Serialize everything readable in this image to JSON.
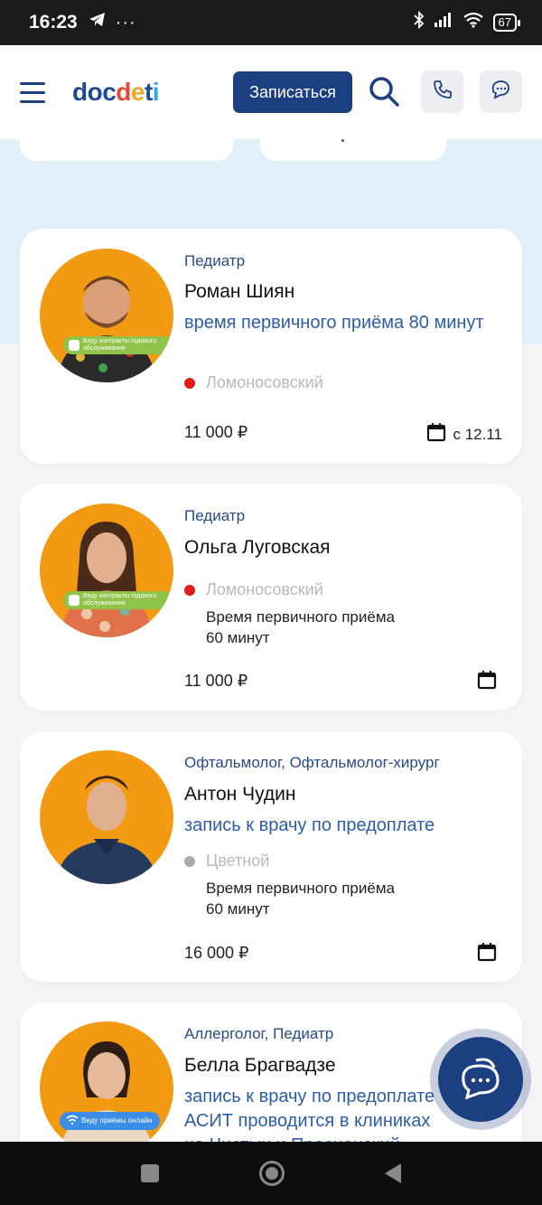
{
  "status_bar": {
    "time": "16:23",
    "battery": "67"
  },
  "header": {
    "logo": {
      "part1": "doc",
      "part2": "d",
      "part3": "e",
      "part4": "t",
      "part5": "i"
    },
    "signup_label": "Записаться"
  },
  "doctors": [
    {
      "specialty": "Педиатр",
      "name": "Роман Шиян",
      "promo": "время первичного приёма 80 минут",
      "clinic": "Ломоносовский",
      "price": "11 000 ₽",
      "date": "с 12.11",
      "badge": "Веду контракты годового обслуживания"
    },
    {
      "specialty": "Педиатр",
      "name": "Ольга Луговская",
      "clinic": "Ломоносовский",
      "time_line1": "Время первичного приёма",
      "time_line2": "60 минут",
      "price": "11 000 ₽",
      "badge": "Веду контракты годового обслуживания"
    },
    {
      "specialty": "Офтальмолог, Офтальмолог-хирург",
      "name": "Антон Чудин",
      "promo": "запись к врачу по предоплате",
      "clinic": "Цветной",
      "time_line1": "Время первичного приёма",
      "time_line2": "60 минут",
      "price": "16 000 ₽"
    },
    {
      "specialty": "Аллерголог, Педиатр",
      "name": "Белла Брагвадзе",
      "promo_line1": "запись к врачу по предоплате",
      "promo_line2": "АСИТ проводится в клиниках",
      "promo_line3": "на Чистых и Пресненский",
      "badge": "Веду приёмы онлайн"
    }
  ],
  "colors": {
    "brand": "#1c3f82",
    "accent_text": "#2c5da6",
    "clinic_dot_red": "#e11a1a",
    "clinic_dot_grey": "#aaaaaa"
  }
}
